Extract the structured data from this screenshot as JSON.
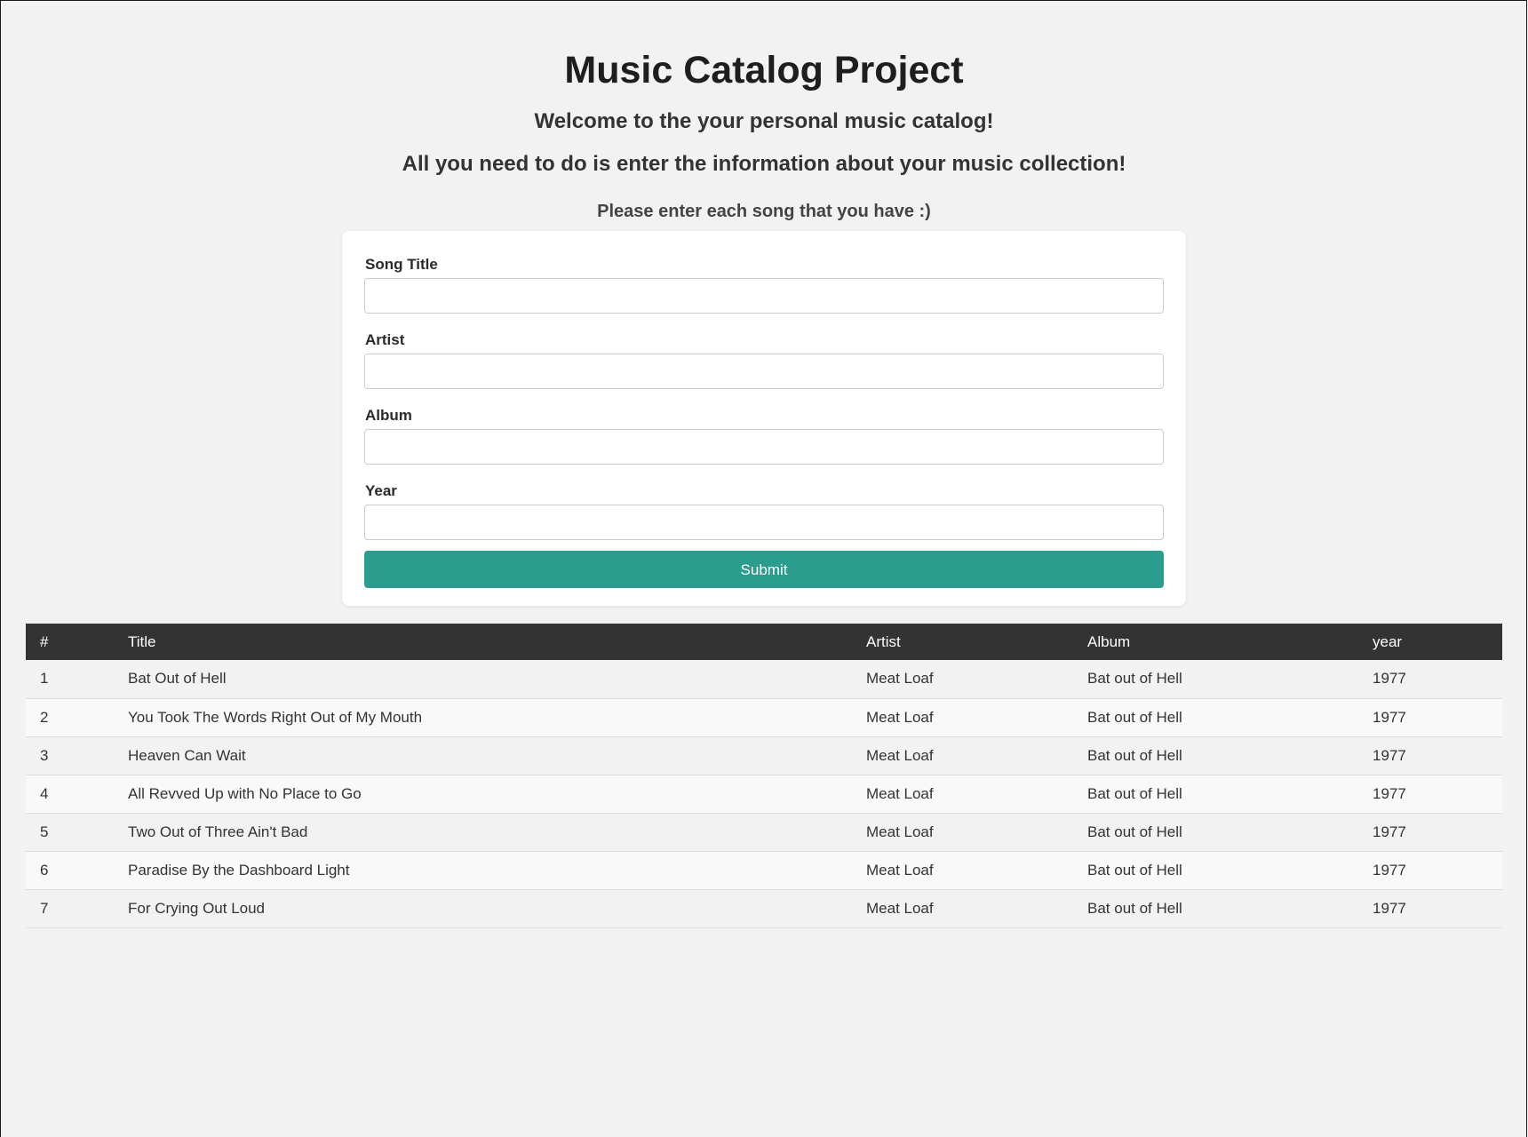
{
  "header": {
    "title": "Music Catalog Project",
    "welcome": "Welcome to the your personal music catalog!",
    "instructions": "All you need to do is enter the information about your music collection!",
    "prompt": "Please enter each song that you have :)"
  },
  "form": {
    "fields": [
      {
        "label": "Song Title",
        "value": "",
        "placeholder": ""
      },
      {
        "label": "Artist",
        "value": "",
        "placeholder": ""
      },
      {
        "label": "Album",
        "value": "",
        "placeholder": ""
      },
      {
        "label": "Year",
        "value": "",
        "placeholder": ""
      }
    ],
    "submit_label": "Submit"
  },
  "table": {
    "headers": [
      "#",
      "Title",
      "Artist",
      "Album",
      "year"
    ],
    "rows": [
      {
        "num": "1",
        "title": "Bat Out of Hell",
        "artist": "Meat Loaf",
        "album": "Bat out of Hell",
        "year": "1977"
      },
      {
        "num": "2",
        "title": "You Took The Words Right Out of My Mouth",
        "artist": "Meat Loaf",
        "album": "Bat out of Hell",
        "year": "1977"
      },
      {
        "num": "3",
        "title": "Heaven Can Wait",
        "artist": "Meat Loaf",
        "album": "Bat out of Hell",
        "year": "1977"
      },
      {
        "num": "4",
        "title": "All Revved Up with No Place to Go",
        "artist": "Meat Loaf",
        "album": "Bat out of Hell",
        "year": "1977"
      },
      {
        "num": "5",
        "title": "Two Out of Three Ain't Bad",
        "artist": "Meat Loaf",
        "album": "Bat out of Hell",
        "year": "1977"
      },
      {
        "num": "6",
        "title": "Paradise By the Dashboard Light",
        "artist": "Meat Loaf",
        "album": "Bat out of Hell",
        "year": "1977"
      },
      {
        "num": "7",
        "title": "For Crying Out Loud",
        "artist": "Meat Loaf",
        "album": "Bat out of Hell",
        "year": "1977"
      }
    ]
  },
  "colors": {
    "background": "#f2f2f2",
    "accent": "#2a9d8f",
    "table_header": "#333333"
  }
}
